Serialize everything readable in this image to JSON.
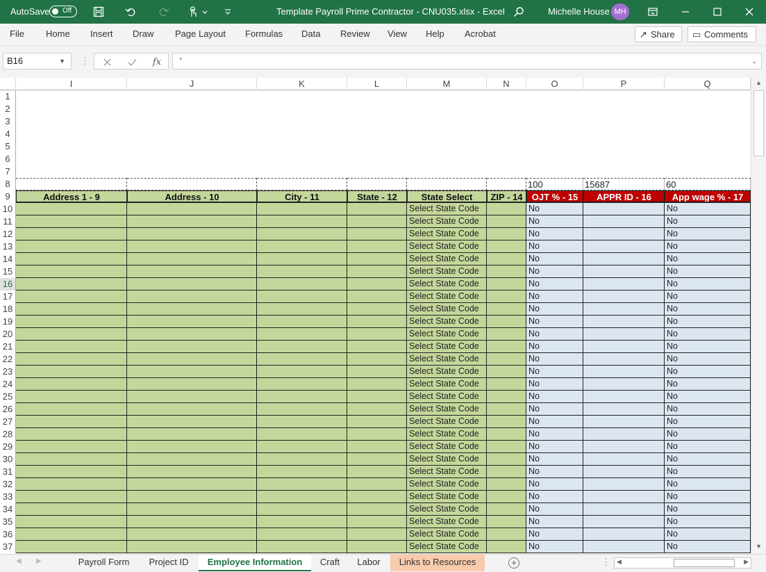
{
  "titlebar": {
    "autosave_label": "AutoSave",
    "autosave_state": "Off",
    "title": "Template Payroll Prime Contractor - CNU035.xlsx  -  Excel",
    "user": "Michelle House",
    "avatar": "MH",
    "accent": "#217346"
  },
  "ribbon": {
    "tabs": [
      "File",
      "Home",
      "Insert",
      "Draw",
      "Page Layout",
      "Formulas",
      "Data",
      "Review",
      "View",
      "Help",
      "Acrobat"
    ],
    "share": "Share",
    "comments": "Comments"
  },
  "formula_bar": {
    "name_box": "B16",
    "formula": "'",
    "fx": "fx"
  },
  "columns": [
    "I",
    "J",
    "K",
    "L",
    "M",
    "N",
    "O",
    "P",
    "Q"
  ],
  "row_numbers": [
    "1",
    "2",
    "3",
    "4",
    "5",
    "6",
    "7",
    "8",
    "9",
    "10",
    "11",
    "12",
    "13",
    "14",
    "15",
    "16",
    "17",
    "18",
    "19",
    "20",
    "21",
    "22",
    "23",
    "24",
    "25",
    "26",
    "27",
    "28",
    "29",
    "30",
    "31",
    "32",
    "33",
    "34",
    "35",
    "36",
    "37"
  ],
  "selected_row": "16",
  "row8_values": {
    "O": "100",
    "P": "15687",
    "Q": "60"
  },
  "header_row": [
    "Address 1 - 9",
    "Address - 10",
    "City - 11",
    "State - 12",
    "State Select",
    "ZIP - 14",
    "OJT % - 15",
    "APPR ID - 16",
    "App wage % - 17"
  ],
  "data_defaults": {
    "M": "Select State Code",
    "O": "No",
    "Q": "No"
  },
  "colors": {
    "green_fill": "#c4d79b",
    "blue_fill": "#dce6f1",
    "red_header": "#c00000"
  },
  "sheet_tabs": [
    "Payroll Form",
    "Project ID",
    "Employee Information",
    "Craft",
    "Labor",
    "Links to Resources"
  ],
  "active_sheet": "Employee Information"
}
